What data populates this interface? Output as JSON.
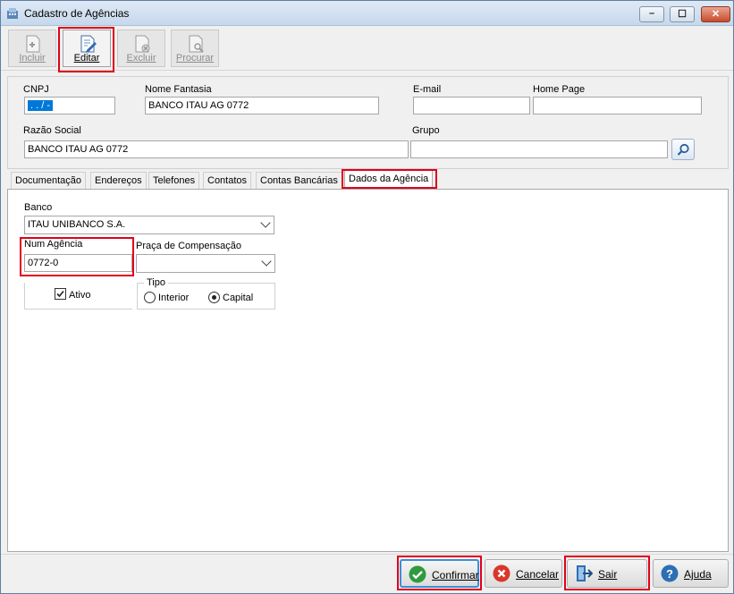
{
  "window": {
    "title": "Cadastro de Agências",
    "min": "–",
    "max": "☐",
    "close": "✕"
  },
  "toolbar": {
    "incluir": "Incluir",
    "editar": "Editar",
    "excluir": "Excluir",
    "procurar": "Procurar"
  },
  "header": {
    "cnpj_label": "CNPJ",
    "cnpj_value": " .   .   /   -  ",
    "nome_fantasia_label": "Nome Fantasia",
    "nome_fantasia_value": "BANCO ITAU AG 0772",
    "email_label": "E-mail",
    "email_value": "",
    "homepage_label": "Home Page",
    "homepage_value": "",
    "razao_label": "Razão Social",
    "razao_value": "BANCO ITAU AG 0772",
    "grupo_label": "Grupo",
    "grupo_value": ""
  },
  "tabs": [
    "Documentação",
    "Endereços",
    "Telefones",
    "Contatos",
    "Contas Bancárias",
    "Dados da Agência"
  ],
  "dados": {
    "banco_label": "Banco",
    "banco_value": "ITAU UNIBANCO S.A.",
    "num_agencia_label": "Num Agência",
    "num_agencia_value": "0772-0",
    "praca_label": "Praça de Compensação",
    "praca_value": "",
    "ativo_label": "Ativo",
    "ativo_checked": true,
    "tipo_label": "Tipo",
    "interior_label": "Interior",
    "capital_label": "Capital",
    "tipo_selected": "Capital"
  },
  "footer": {
    "confirmar": "Confirmar",
    "cancelar": "Cancelar",
    "sair": "Sair",
    "ajuda": "Ajuda"
  },
  "colors": {
    "highlight": "#e0001b",
    "confirm": "#2e9b3e",
    "cancel": "#d9372a",
    "exit": "#2c6fb3",
    "help": "#2c6fb3"
  }
}
